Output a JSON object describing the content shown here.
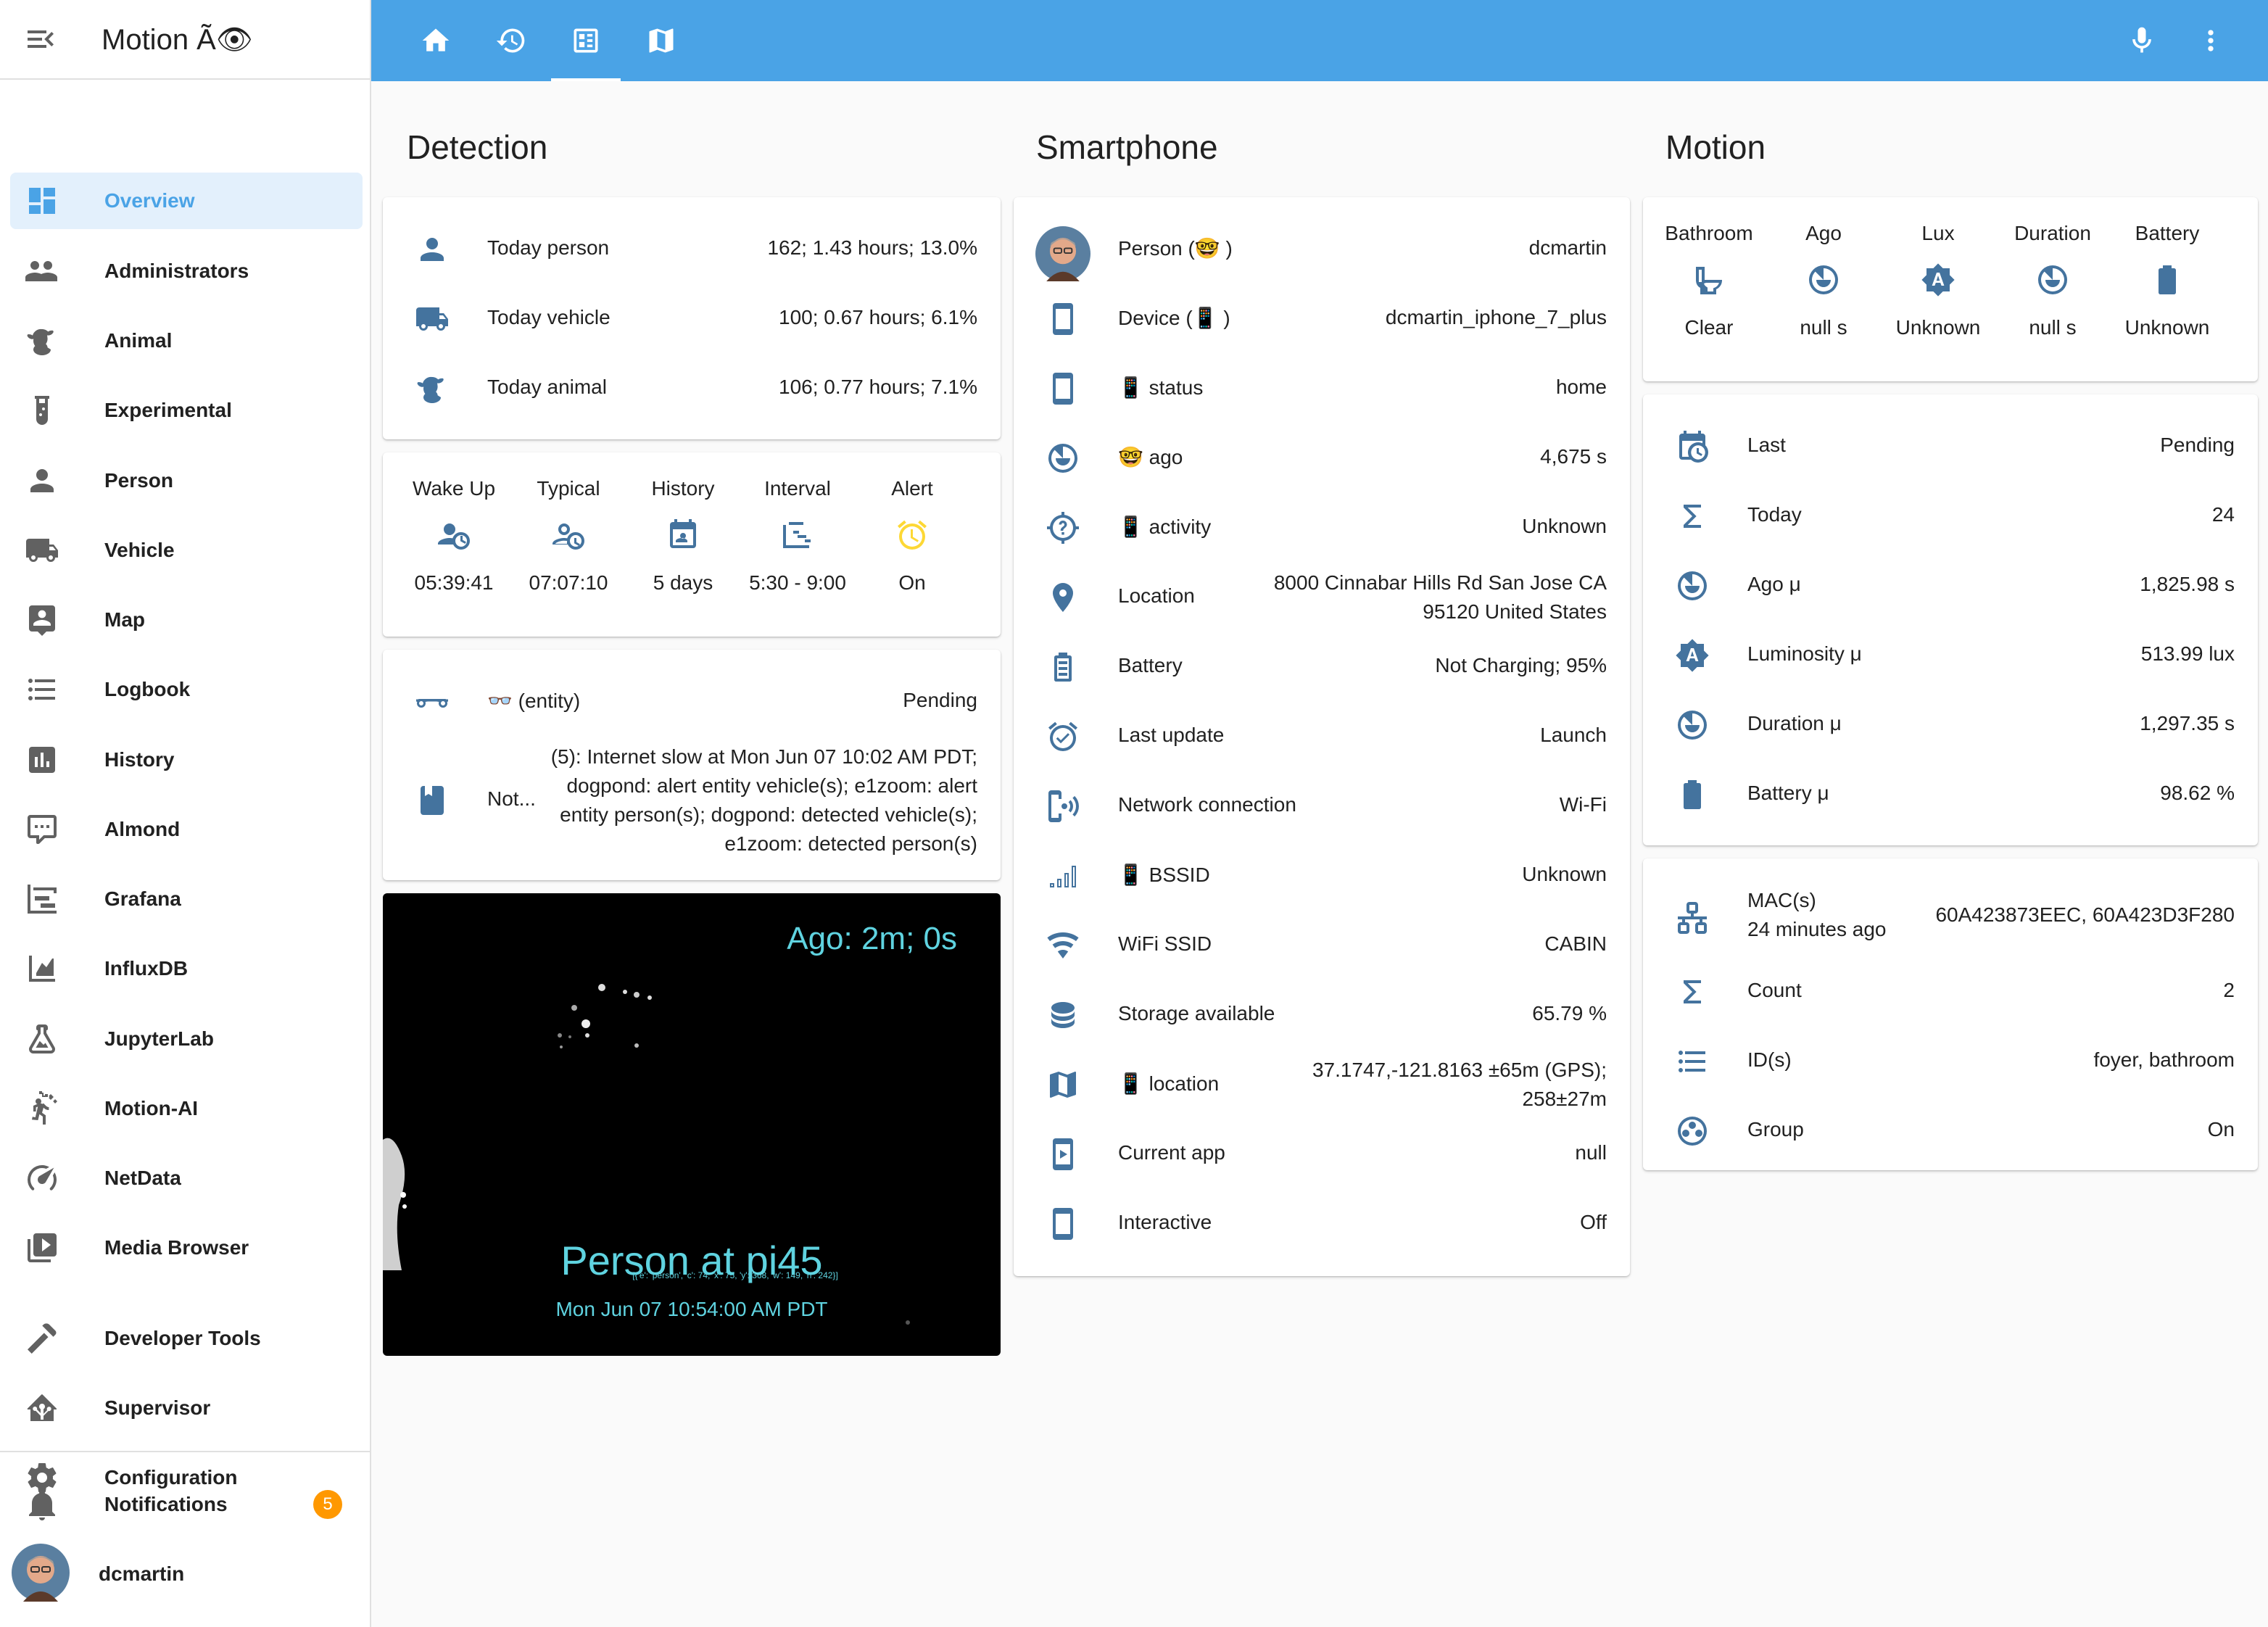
{
  "app": {
    "title": "Motion Ã👁"
  },
  "sidebar": {
    "items": [
      {
        "label": "Overview",
        "icon": "view-dashboard-icon"
      },
      {
        "label": "Administrators",
        "icon": "account-group-icon"
      },
      {
        "label": "Animal",
        "icon": "cow-icon"
      },
      {
        "label": "Experimental",
        "icon": "test-tube-icon"
      },
      {
        "label": "Person",
        "icon": "account-icon"
      },
      {
        "label": "Vehicle",
        "icon": "truck-icon"
      },
      {
        "label": "Map",
        "icon": "account-box-icon"
      },
      {
        "label": "Logbook",
        "icon": "format-list-icon"
      },
      {
        "label": "History",
        "icon": "chart-box-icon"
      },
      {
        "label": "Almond",
        "icon": "comment-processing-icon"
      },
      {
        "label": "Grafana",
        "icon": "chart-timeline-icon"
      },
      {
        "label": "InfluxDB",
        "icon": "chart-areaspline-icon"
      },
      {
        "label": "JupyterLab",
        "icon": "flask-icon"
      },
      {
        "label": "Motion-AI",
        "icon": "motion-sensor-icon"
      },
      {
        "label": "NetData",
        "icon": "speedometer-icon"
      },
      {
        "label": "Media Browser",
        "icon": "play-box-multiple-icon"
      }
    ],
    "tools": [
      {
        "label": "Developer Tools",
        "icon": "hammer-icon"
      },
      {
        "label": "Supervisor",
        "icon": "home-assistant-icon"
      },
      {
        "label": "Configuration",
        "icon": "cog-icon"
      }
    ],
    "notifications": {
      "label": "Notifications",
      "count": "5"
    },
    "user": {
      "label": "dcmartin"
    }
  },
  "topbar": {
    "tabs": [
      "home-icon",
      "history-icon",
      "dashboard-icon",
      "map-icon"
    ],
    "active_tab": 2,
    "actions": [
      "microphone-icon",
      "more-vertical-icon"
    ]
  },
  "colors": {
    "accent": "#4aa3e6",
    "icon": "#44739e",
    "alert_icon": "#fdd835",
    "badge": "#ff9800",
    "camera_text": "#5fd3e0"
  },
  "detection": {
    "title": "Detection",
    "entities": [
      {
        "icon": "account-icon",
        "label": "Today person",
        "value": "162; 1.43 hours; 13.0%"
      },
      {
        "icon": "truck-icon",
        "label": "Today vehicle",
        "value": "100; 0.67 hours; 6.1%"
      },
      {
        "icon": "cow-icon",
        "label": "Today animal",
        "value": "106; 0.77 hours; 7.1%"
      }
    ],
    "glance": [
      {
        "name": "Wake Up",
        "icon": "account-clock-icon",
        "state": "05:39:41"
      },
      {
        "name": "Typical",
        "icon": "account-clock-outline-icon",
        "state": "07:07:10"
      },
      {
        "name": "History",
        "icon": "calendar-account-icon",
        "state": "5 days"
      },
      {
        "name": "Interval",
        "icon": "chart-gantt-icon",
        "state": "5:30 - 9:00"
      },
      {
        "name": "Alert",
        "icon": "alarm-icon",
        "state": "On"
      }
    ],
    "entity_card": {
      "row1": {
        "icon": "glasses-icon",
        "label": "👓 (entity)",
        "value": "Pending"
      },
      "row2": {
        "icon": "notebook-icon",
        "label": "Not...",
        "value": "(5): Internet slow at Mon Jun 07 10:02 AM PDT; dogpond: alert entity vehicle(s); e1zoom: alert entity person(s); dogpond: detected vehicle(s); e1zoom: detected person(s)"
      }
    },
    "camera": {
      "ago": "Ago: 2m; 0s",
      "title": "Person at pi45",
      "detail": "[{'e': 'person', 'c': 74, 'x': 75, 'y': 368, 'w': 149, 'h': 242}]",
      "date": "Mon Jun 07 10:54:00 AM PDT"
    }
  },
  "smartphone": {
    "title": "Smartphone",
    "rows": [
      {
        "icon": "avatar",
        "label": "Person (🤓 )",
        "value": "dcmartin"
      },
      {
        "icon": "cellphone-icon",
        "label": "Device (📱 )",
        "value": "dcmartin_iphone_7_plus"
      },
      {
        "icon": "cellphone-icon",
        "label": "📱 status",
        "value": "home"
      },
      {
        "icon": "timer-icon",
        "label": "🤓 ago",
        "value": "4,675 s"
      },
      {
        "icon": "crosshairs-question-icon",
        "label": "📱 activity",
        "value": "Unknown"
      },
      {
        "icon": "map-marker-icon",
        "label": "Location",
        "value": "8000 Cinnabar Hills Rd San Jose CA 95120 United States"
      },
      {
        "icon": "battery-outline-icon",
        "label": "Battery",
        "value": "Not Charging; 95%"
      },
      {
        "icon": "alarm-check-icon",
        "label": "Last update",
        "value": "Launch"
      },
      {
        "icon": "cellphone-wireless-icon",
        "label": "Network connection",
        "value": "Wi-Fi"
      },
      {
        "icon": "signal-icon",
        "label": "📱 BSSID",
        "value": "Unknown"
      },
      {
        "icon": "wifi-icon",
        "label": "WiFi SSID",
        "value": "CABIN"
      },
      {
        "icon": "database-icon",
        "label": "Storage available",
        "value": "65.79 %"
      },
      {
        "icon": "map-icon",
        "label": "📱 location",
        "value": "37.1747,-121.8163 ±65m (GPS); 258±27m"
      },
      {
        "icon": "cellphone-play-icon",
        "label": "Current app",
        "value": "null"
      },
      {
        "icon": "cellphone-icon",
        "label": "Interactive",
        "value": "Off"
      }
    ]
  },
  "motion": {
    "title": "Motion",
    "glance": [
      {
        "name": "Bathroom",
        "icon": "toilet-icon",
        "state": "Clear"
      },
      {
        "name": "Ago",
        "icon": "timer-icon",
        "state": "null s"
      },
      {
        "name": "Lux",
        "icon": "brightness-auto-icon",
        "state": "Unknown"
      },
      {
        "name": "Duration",
        "icon": "timer-icon",
        "state": "null s"
      },
      {
        "name": "Battery",
        "icon": "battery-icon",
        "state": "Unknown"
      }
    ],
    "stats": [
      {
        "icon": "calendar-clock-icon",
        "label": "Last",
        "value": "Pending"
      },
      {
        "icon": "sigma-icon",
        "label": "Today",
        "value": "24"
      },
      {
        "icon": "timer-icon",
        "label": "Ago μ",
        "value": "1,825.98 s"
      },
      {
        "icon": "brightness-auto-icon",
        "label": "Luminosity μ",
        "value": "513.99 lux"
      },
      {
        "icon": "timer-icon",
        "label": "Duration μ",
        "value": "1,297.35 s"
      },
      {
        "icon": "battery-icon",
        "label": "Battery μ",
        "value": "98.62 %"
      }
    ],
    "devices": [
      {
        "icon": "lan-icon",
        "label": "MAC(s)",
        "secondary": "24 minutes ago",
        "value": "60A423873EEC, 60A423D3F280"
      },
      {
        "icon": "sigma-icon",
        "label": "Count",
        "value": "2"
      },
      {
        "icon": "format-list-icon",
        "label": "ID(s)",
        "value": "foyer, bathroom"
      },
      {
        "icon": "google-circles-icon",
        "label": "Group",
        "value": "On"
      }
    ]
  }
}
